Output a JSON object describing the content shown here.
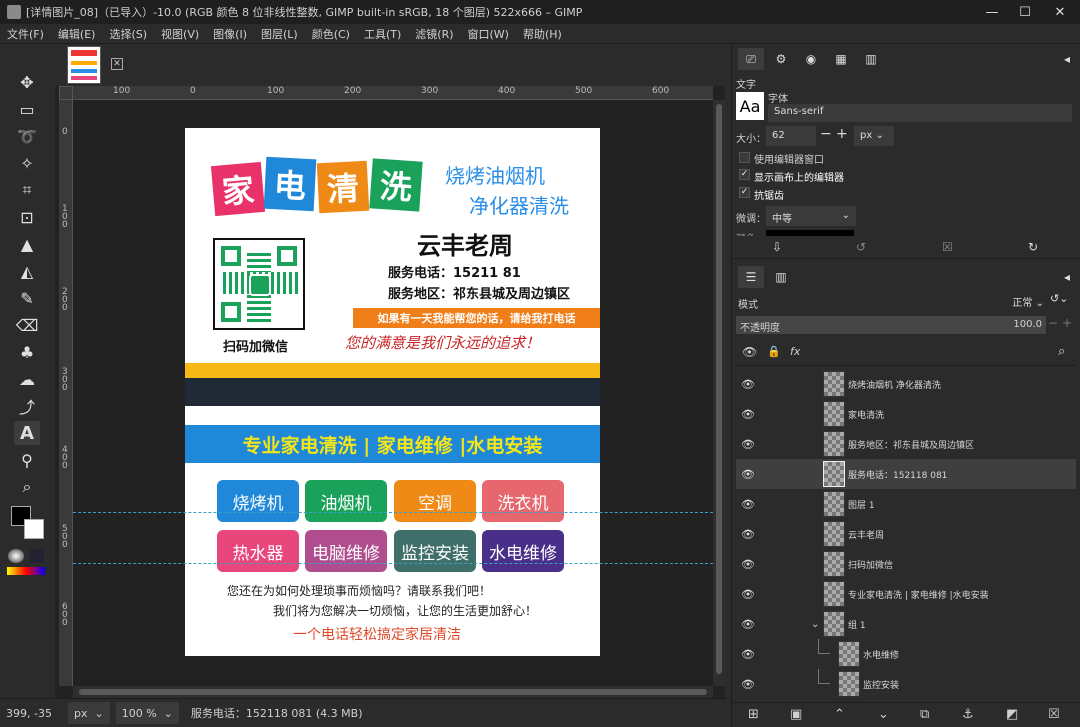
{
  "window": {
    "title": "[详情图片_08]（已导入）-10.0 (RGB 颜色 8 位非线性整数, GIMP built-in sRGB, 18 个图层) 522x666 – GIMP",
    "minimize": "—",
    "maximize": "☐",
    "close": "✕"
  },
  "menu": [
    "文件(F)",
    "编辑(E)",
    "选择(S)",
    "视图(V)",
    "图像(I)",
    "图层(L)",
    "颜色(C)",
    "工具(T)",
    "滤镜(R)",
    "窗口(W)",
    "帮助(H)"
  ],
  "ruler": {
    "h": [
      "100",
      "0",
      "100",
      "200",
      "300",
      "400",
      "500",
      "600"
    ],
    "v": [
      "0",
      "1\n0\n0",
      "2\n0\n0",
      "3\n0\n0",
      "4\n0\n0",
      "5\n0\n0",
      "6\n0\n0"
    ]
  },
  "card": {
    "brand_chars": [
      "家",
      "电",
      "清",
      "洗"
    ],
    "slogan1": "烧烤油烟机",
    "slogan2": "净化器清洗",
    "name": "云丰老周",
    "phone": "服务电话：15211    81",
    "area": "服务地区：祁东县城及周边镇区",
    "banner": "如果有一天我能帮您的话，请给我打电话",
    "motto": "您的满意是我们永远的追求！",
    "qr_caption": "扫码加微信",
    "services_banner": "专业家电清洗 | 家电维修 |水电安装",
    "services": [
      "烧烤机",
      "油烟机",
      "空调",
      "洗衣机",
      "热水器",
      "电脑维修",
      "监控安装",
      "水电维修"
    ],
    "service_colors": [
      "#1f88d8",
      "#1aa15a",
      "#ef8a16",
      "#e6676e",
      "#e8477c",
      "#b04d8f",
      "#3f6f68",
      "#4a2f8a"
    ],
    "line1": "您还在为如何处理琐事而烦恼吗？请联系我们吧！",
    "line2": "我们将为您解决一切烦恼，让您的生活更加舒心！",
    "line3": "一个电话轻松搞定家居清洁"
  },
  "status": {
    "coords": "399, -35",
    "unit": "px",
    "zoom": "100 %",
    "message": "服务电话：152118  081 (4.3 MB)"
  },
  "tool_options": {
    "title": "文字",
    "font_label": "字体",
    "font_value": "Sans-serif",
    "size_label": "大小：",
    "size_value": "62",
    "size_unit": "px",
    "opt_editor": "使用编辑器窗口",
    "opt_show_editor": "显示画布上的编辑器",
    "opt_antialias": "抗锯齿",
    "hinting_label": "微调：",
    "hinting_value": "中等",
    "partial_label": "颜色"
  },
  "layers": {
    "mode_label": "模式",
    "mode_value": "正常",
    "opacity_label": "不透明度",
    "opacity_value": "100.0",
    "items": [
      {
        "name": "烧烤油烟机   净化器清洗",
        "indent": 0
      },
      {
        "name": "家电清洗",
        "indent": 0
      },
      {
        "name": "服务地区：祁东县城及周边镇区",
        "indent": 0
      },
      {
        "name": "服务电话：152118  081",
        "indent": 0
      },
      {
        "name": "图层 1",
        "indent": 0
      },
      {
        "name": "云丰老周",
        "indent": 0
      },
      {
        "name": "扫码加微信",
        "indent": 0
      },
      {
        "name": "专业家电清洗 | 家电维修 |水电安装",
        "indent": 0
      },
      {
        "name": "组 1",
        "indent": 0
      },
      {
        "name": "水电维修",
        "indent": 1
      },
      {
        "name": "监控安装",
        "indent": 1
      }
    ]
  }
}
